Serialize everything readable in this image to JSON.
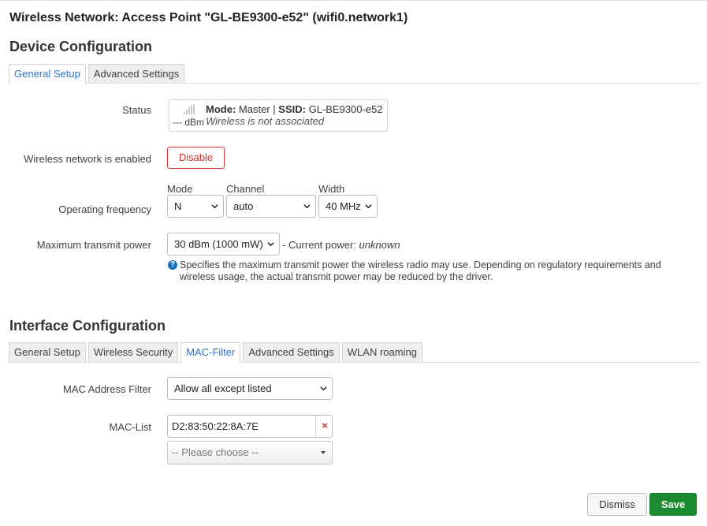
{
  "window_title": "Wireless Network: Access Point \"GL-BE9300-e52\" (wifi0.network1)",
  "device_config": {
    "heading": "Device Configuration",
    "tabs": [
      {
        "label": "General Setup",
        "active": true
      },
      {
        "label": "Advanced Settings",
        "active": false
      }
    ],
    "status": {
      "label": "Status",
      "signal_icon": "signal-bars-icon",
      "dbm": "--- dBm",
      "mode_key": "Mode:",
      "mode_value": "Master",
      "separator": "|",
      "ssid_key": "SSID:",
      "ssid_value": "GL-BE9300-e52",
      "assoc": "Wireless is not associated"
    },
    "enabled": {
      "label": "Wireless network is enabled",
      "button": "Disable"
    },
    "frequency": {
      "label": "Operating frequency",
      "mode_label": "Mode",
      "mode_value": "N",
      "channel_label": "Channel",
      "channel_value": "auto",
      "width_label": "Width",
      "width_value": "40 MHz"
    },
    "txpower": {
      "label": "Maximum transmit power",
      "value": "30 dBm (1000 mW)",
      "current_prefix": "- Current power:",
      "current_value": "unknown",
      "hint": "Specifies the maximum transmit power the wireless radio may use. Depending on regulatory requirements and wireless usage, the actual transmit power may be reduced by the driver."
    }
  },
  "interface_config": {
    "heading": "Interface Configuration",
    "tabs": [
      {
        "label": "General Setup",
        "active": false
      },
      {
        "label": "Wireless Security",
        "active": false
      },
      {
        "label": "MAC-Filter",
        "active": true
      },
      {
        "label": "Advanced Settings",
        "active": false
      },
      {
        "label": "WLAN roaming",
        "active": false
      }
    ],
    "mac_filter": {
      "label": "MAC Address Filter",
      "value": "Allow all except listed"
    },
    "mac_list": {
      "label": "MAC-List",
      "entries": [
        "D2:83:50:22:8A:7E"
      ],
      "remove_symbol": "×",
      "placeholder": "-- Please choose --"
    }
  },
  "footer": {
    "dismiss": "Dismiss",
    "save": "Save"
  },
  "colors": {
    "accent": "#2a73c7",
    "danger": "#d23131",
    "save": "#1a8b2e"
  }
}
